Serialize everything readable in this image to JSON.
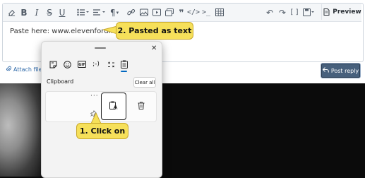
{
  "editor": {
    "toolbar": {
      "icons": [
        "eraser-icon",
        "bold-icon",
        "italic-icon",
        "strikethrough-icon",
        "underline-icon",
        "bullet-list-icon",
        "align-icon",
        "paragraph-icon",
        "link-icon",
        "image-icon",
        "media-icon",
        "gallery-icon",
        "quote-icon",
        "code-icon",
        "spoiler-icon",
        "table-icon",
        "undo-icon",
        "redo-icon",
        "brackets-icon",
        "save-draft-icon"
      ],
      "preview_label": "Preview"
    },
    "paste_label": "Paste here:",
    "paste_value": "www.elevenforum.com",
    "attach_label": "Attach files",
    "post_reply_label": "Post reply"
  },
  "clipboard_panel": {
    "tabs": [
      "sticker-icon",
      "emoji-icon",
      "gif-icon",
      "kaomoji-icon",
      "symbols-icon",
      "clipboard-icon"
    ],
    "active_tab": "clipboard-icon",
    "section_title": "Clipboard",
    "clear_all_label": "Clear all",
    "item": {
      "more_label": "···",
      "paste_as_text_icon": "paste-as-text-icon",
      "delete_icon": "trash-icon"
    }
  },
  "callouts": {
    "step1": "1. Click on",
    "step2": "2. Pasted as text"
  },
  "colors": {
    "callout": "#f6e05a",
    "post_reply_bg": "#47607c",
    "accent": "#0067c0"
  }
}
